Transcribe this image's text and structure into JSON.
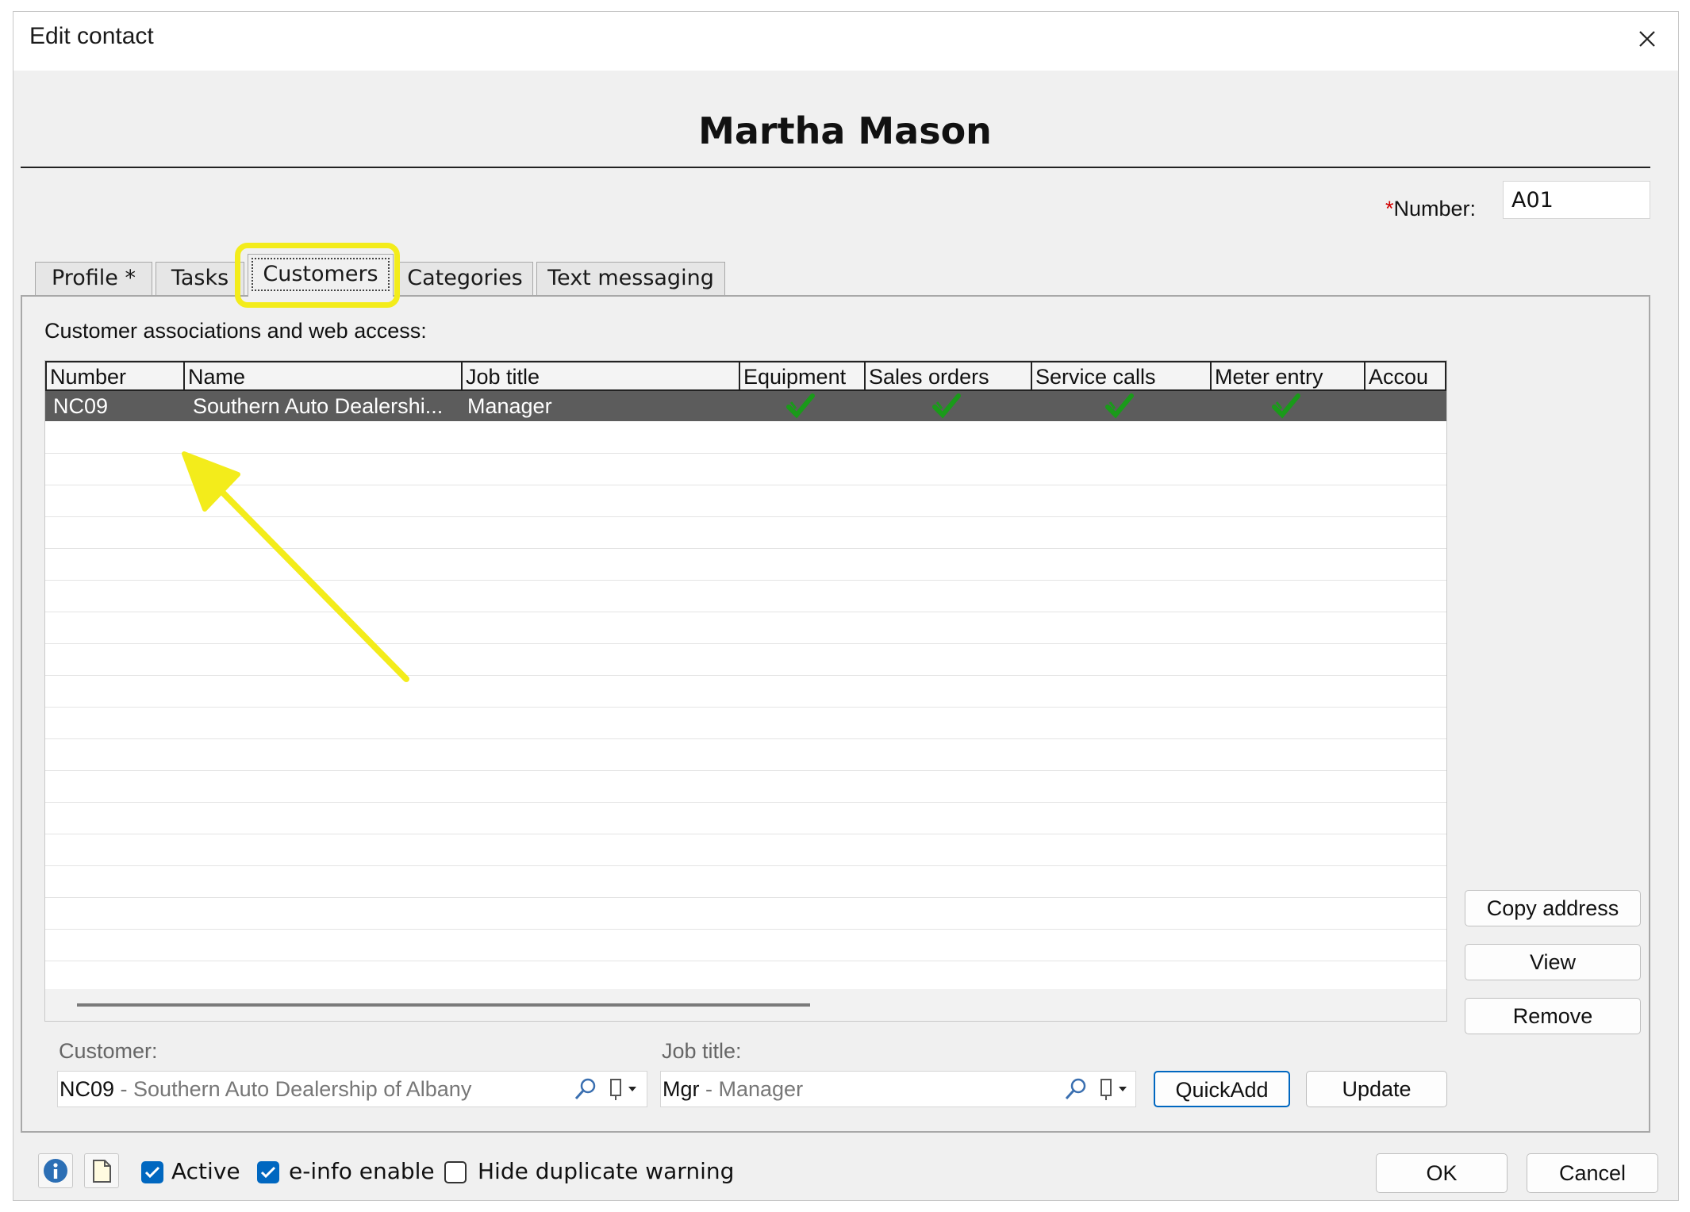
{
  "window": {
    "title": "Edit contact"
  },
  "contact": {
    "name": "Martha Mason"
  },
  "number": {
    "label_req": "*",
    "label": "Number:",
    "value": "A01"
  },
  "tabs": [
    {
      "label": "Profile *"
    },
    {
      "label": "Tasks"
    },
    {
      "label": "Customers",
      "active": true
    },
    {
      "label": "Categories"
    },
    {
      "label": "Text messaging"
    }
  ],
  "section": {
    "label": "Customer associations and web access:"
  },
  "grid": {
    "columns": [
      "Number",
      "Name",
      "Job title",
      "Equipment",
      "Sales orders",
      "Service calls",
      "Meter entry",
      "Accou"
    ],
    "rows": [
      {
        "number": "NC09",
        "name": "Southern Auto Dealershi...",
        "job_title": "Manager",
        "equipment": true,
        "sales_orders": true,
        "service_calls": true,
        "meter_entry": true
      }
    ]
  },
  "side_buttons": {
    "copy_address": "Copy address",
    "view": "View",
    "remove": "Remove"
  },
  "customer_field": {
    "label": "Customer:",
    "code": "NC09",
    "separator": " - ",
    "desc": "Southern Auto Dealership of Albany"
  },
  "job_title_field": {
    "label": "Job title:",
    "code": "Mgr",
    "separator": " - ",
    "desc": "Manager"
  },
  "actions": {
    "quickadd": "QuickAdd",
    "update": "Update"
  },
  "footer": {
    "active_label": "Active",
    "active_checked": true,
    "einfo_label": "e-info enable",
    "einfo_checked": true,
    "hide_dup_label": "Hide duplicate warning",
    "hide_dup_checked": false,
    "ok": "OK",
    "cancel": "Cancel"
  },
  "colors": {
    "annotation_yellow": "#f3ec1b",
    "selected_row": "#5c5c5c",
    "checkbox_blue": "#0067c0",
    "check_green": "#1a9a1a"
  }
}
